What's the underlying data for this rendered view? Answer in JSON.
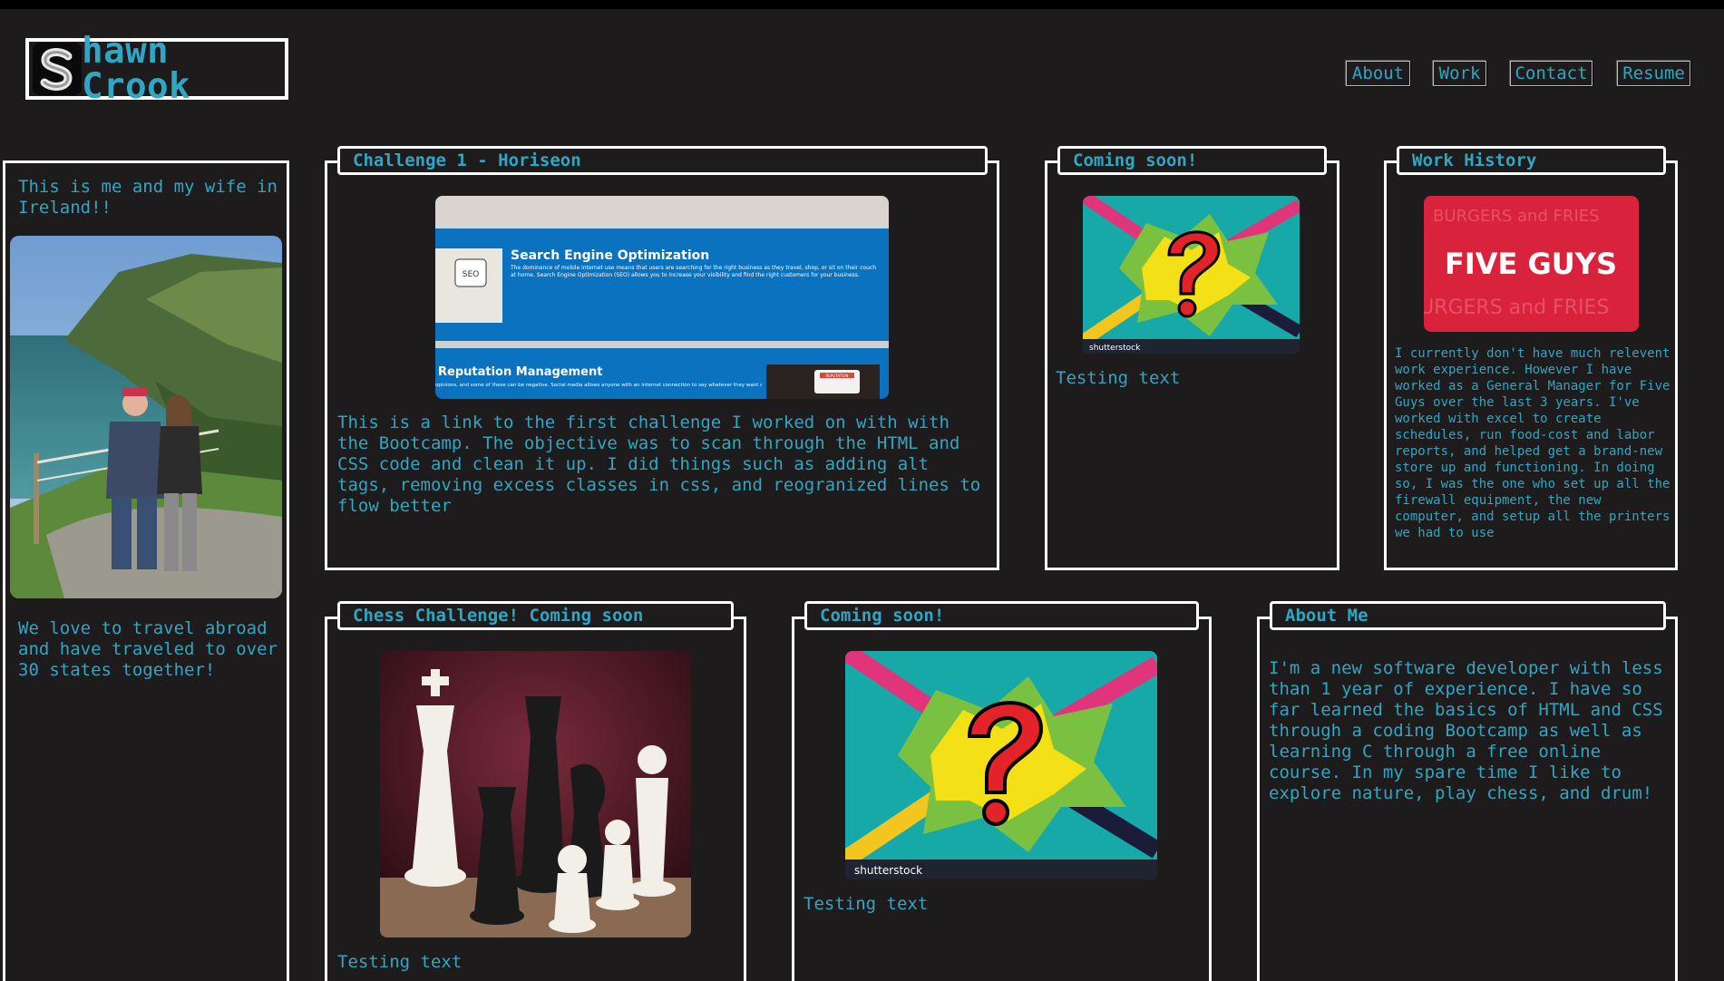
{
  "header": {
    "logo_letter": "S",
    "logo_rest": "hawn Crook"
  },
  "nav": {
    "about": "About",
    "work": "Work",
    "contact": "Contact",
    "resume": "Resume"
  },
  "sidebar": {
    "top_text": "This is me and my wife in Ireland!!",
    "bottom_text": "We love to travel abroad and have traveled to over 30 states together!"
  },
  "cards": {
    "horiseon": {
      "title": "Challenge 1 - Horiseon",
      "seo_heading": "Search Engine Optimization",
      "seo_body": "The dominance of mobile internet use means that users are searching for the right business as they travel, shop, or sit on their couch at home. Search Engine Optimization (SEO) allows you to increase your visibility and find the right customers for your business.",
      "rep_heading": "Reputation Management",
      "rep_body": "opinions, and some of these can be negative. Social media allows anyone with an internet connection to say whatever they want about ... Reputation Management gives you the control over what potential customers see when they search for your business.",
      "seo_tag": "SEO",
      "rep_tag": "REPUTATION",
      "description": "This is a link to the first challenge I worked on with with the Bootcamp. The objective was to scan through the HTML and CSS code and clean it up. I did things such as adding alt tags, removing excess classes in css, and reogranized lines to flow better"
    },
    "coming1": {
      "title": "Coming soon!",
      "watermark": "shutterstock",
      "caption": "Testing text"
    },
    "work_history": {
      "title": "Work History",
      "logo_text": "FIVE GUYS",
      "pattern_text": "BURGERS and FRIES",
      "body": "I currently don't have much relevent work experience. However I have worked as a General Manager for Five Guys over the last 3 years. I've worked with excel to create schedules, run food-cost and labor reports, and helped get a brand-new store up and functioning. In doing so, I was the one who set up all the firewall equipment, the new computer, and setup all the printers we had to use"
    },
    "chess": {
      "title": "Chess Challenge! Coming soon",
      "caption": "Testing text"
    },
    "coming2": {
      "title": "Coming soon!",
      "watermark": "shutterstock",
      "caption": "Testing text"
    },
    "about": {
      "title": "About Me",
      "body": "I'm a new software developer with less than 1 year of experience. I have so far learned the basics of HTML and CSS through a coding Bootcamp as well as learning C through a free online course. In my spare time I like to explore nature, play chess, and drum!"
    }
  },
  "colors": {
    "background": "#1d1b1b",
    "accent": "#31a6c3",
    "border": "#ffffff"
  }
}
